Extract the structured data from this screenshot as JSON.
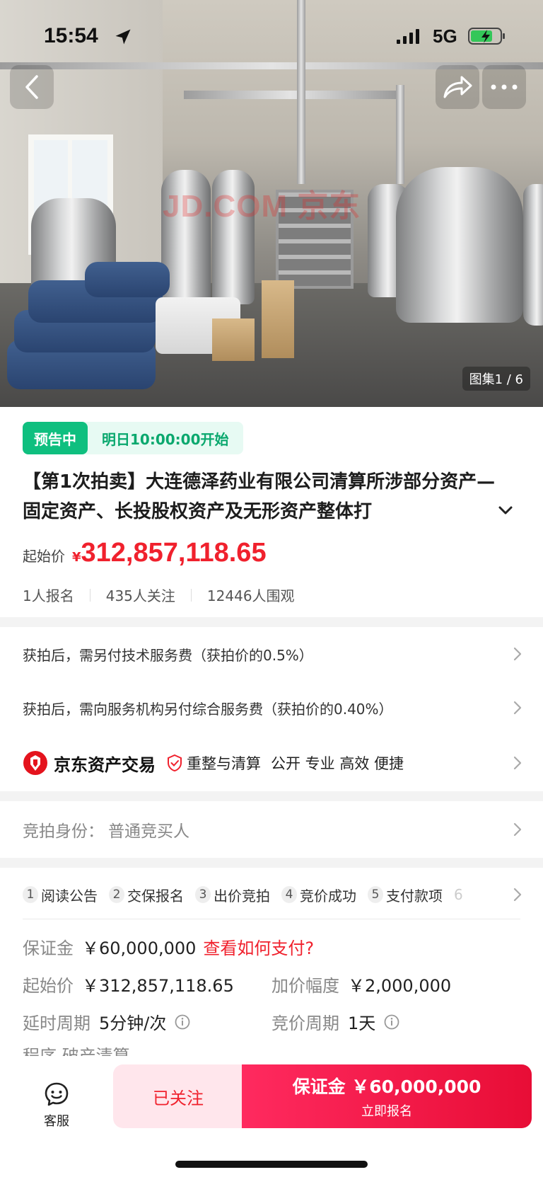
{
  "status_bar": {
    "time": "15:54",
    "network": "5G",
    "icons": [
      "location-arrow-icon",
      "signal-icon",
      "battery-charging-icon"
    ]
  },
  "gallery": {
    "watermark": "JD.COM 京东",
    "counter": "图集1 / 6",
    "nav_icons": [
      "back-icon",
      "share-icon",
      "more-icon"
    ]
  },
  "auction": {
    "status": "预告中",
    "start_time": "明日10:00:00开始",
    "title": "【第1次拍卖】大连德泽药业有限公司清算所涉部分资产—固定资产、长投股权资产及无形资产整体打",
    "start_price_label": "起始价",
    "currency": "¥",
    "start_price": "312,857,118.65",
    "stats": [
      "1人报名",
      "435人关注",
      "12446人围观"
    ]
  },
  "fees": [
    "获拍后，需另付技术服务费（获拍价的0.5%）",
    "获拍后，需向服务机构另付综合服务费（获拍价的0.40%）"
  ],
  "brand": {
    "name": "京东资产交易",
    "tag": "重整与清算",
    "slogan": "公开 专业 高效 便捷"
  },
  "identity": {
    "label": "竞拍身份：",
    "value": "普通竞买人"
  },
  "steps": [
    {
      "num": "1",
      "label": "阅读公告"
    },
    {
      "num": "2",
      "label": "交保报名"
    },
    {
      "num": "3",
      "label": "出价竞拍"
    },
    {
      "num": "4",
      "label": "竞价成功"
    },
    {
      "num": "5",
      "label": "支付款项"
    },
    {
      "num": "6",
      "label": ""
    }
  ],
  "details": {
    "deposit_label": "保证金",
    "deposit_value": "￥60,000,000",
    "pay_link": "查看如何支付?",
    "start_price_label": "起始价",
    "start_price_value": "￥312,857,118.65",
    "increment_label": "加价幅度",
    "increment_value": "￥2,000,000",
    "extension_label": "延时周期",
    "extension_value": "5分钟/次",
    "cycle_label": "竞价周期",
    "cycle_value": "1天",
    "cutoff_text": "程序 破产清算"
  },
  "bottom_bar": {
    "service_label": "客服",
    "follow_label": "已关注",
    "register_main": "保证金 ￥60,000,000",
    "register_sub": "立即报名"
  },
  "colors": {
    "accent_red": "#f0212d",
    "presale_green": "#0fbf7f",
    "register_gradient_start": "#ff2a5f",
    "register_gradient_end": "#e80d36"
  }
}
